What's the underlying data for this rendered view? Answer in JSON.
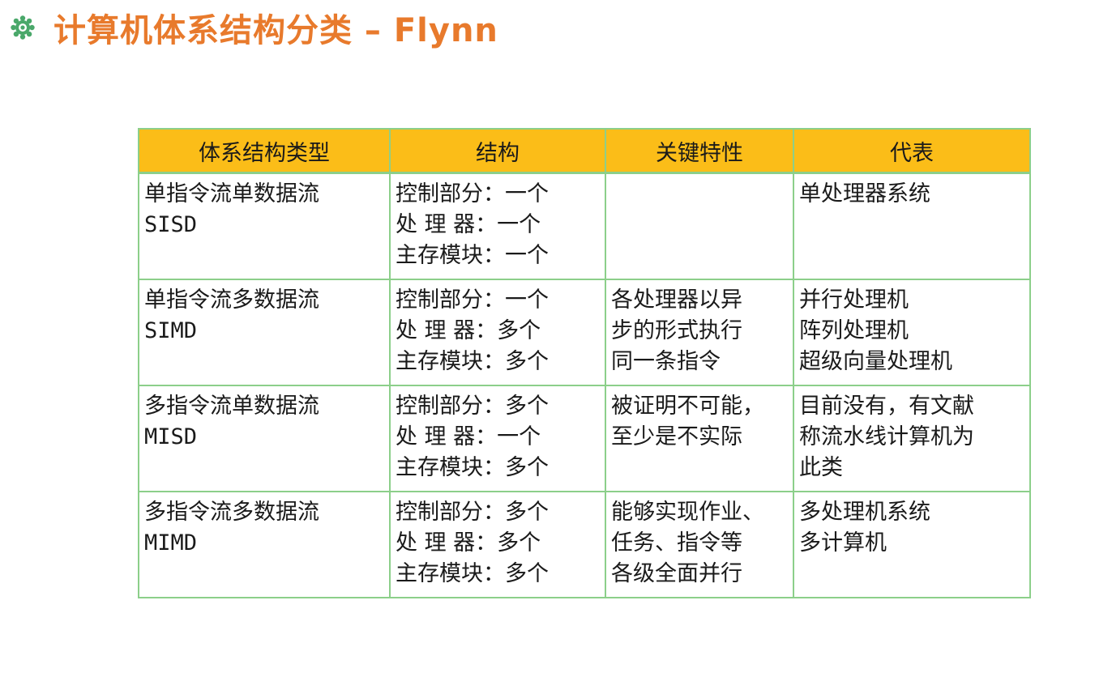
{
  "slide": {
    "title": "计算机体系结构分类 – Flynn",
    "bullet_icon": "gear-flower-icon",
    "title_color": "#e87a2c",
    "bullet_color": "#4aa86a"
  },
  "table": {
    "header_bg": "#fbbd18",
    "border_color": "#8ccf8a",
    "headers": [
      "体系结构类型",
      "结构",
      "关键特性",
      "代表"
    ],
    "rows": [
      {
        "type": [
          "单指令流单数据流",
          "SISD"
        ],
        "structure": [
          "控制部分：一个",
          "处 理 器：一个",
          "主存模块：一个"
        ],
        "features": [],
        "examples": [
          "单处理器系统"
        ]
      },
      {
        "type": [
          "单指令流多数据流",
          "SIMD"
        ],
        "structure": [
          "控制部分：一个",
          "处 理 器：多个",
          "主存模块：多个"
        ],
        "features": [
          "各处理器以异",
          "步的形式执行",
          "同一条指令"
        ],
        "examples": [
          "并行处理机",
          "阵列处理机",
          "超级向量处理机"
        ]
      },
      {
        "type": [
          "多指令流单数据流",
          "MISD"
        ],
        "structure": [
          "控制部分：多个",
          "处 理 器：一个",
          "主存模块：多个"
        ],
        "features": [
          "被证明不可能，",
          "至少是不实际"
        ],
        "examples": [
          "目前没有，有文献",
          "称流水线计算机为",
          "此类"
        ]
      },
      {
        "type": [
          "多指令流多数据流",
          "MIMD"
        ],
        "structure": [
          "控制部分：多个",
          "处 理 器：多个",
          "主存模块：多个"
        ],
        "features": [
          "能够实现作业、",
          "任务、指令等",
          "各级全面并行"
        ],
        "examples": [
          "多处理机系统",
          "多计算机"
        ]
      }
    ]
  }
}
